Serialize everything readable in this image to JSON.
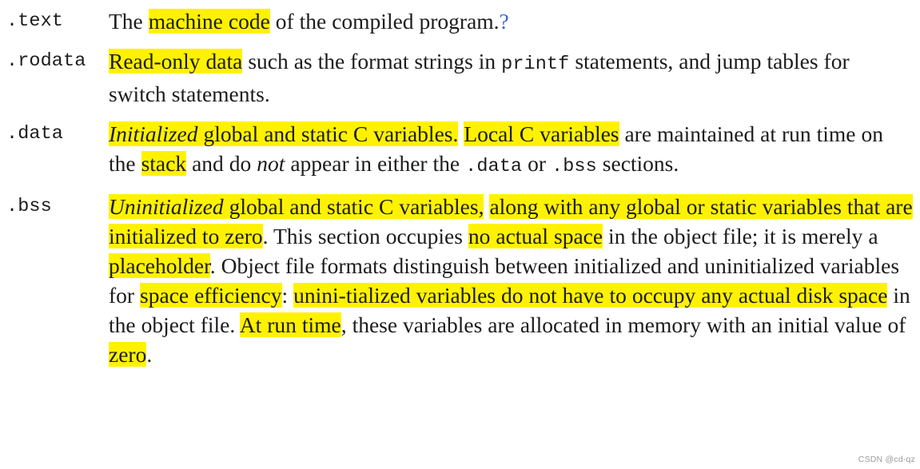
{
  "document": {
    "kind": "textbook-excerpt",
    "topic": "ELF object file sections",
    "highlight_color": "#fff200",
    "question_marker_color": "#3b5fd0",
    "text_color": "#1c1c1c"
  },
  "entries": [
    {
      "label": ".text",
      "id": "text",
      "segments": [
        {
          "text": "The ",
          "style": "plain"
        },
        {
          "text": "machine code",
          "style": "highlight"
        },
        {
          "text": " of the compiled program. ",
          "style": "plain"
        },
        {
          "text": "?",
          "style": "question-marker"
        }
      ],
      "plain": "The machine code of the compiled program. ?"
    },
    {
      "label": ".rodata",
      "id": "rodata",
      "segments": [
        {
          "text": "Read-only data",
          "style": "highlight"
        },
        {
          "text": " such as the format strings in ",
          "style": "plain"
        },
        {
          "text": "printf",
          "style": "mono"
        },
        {
          "text": " statements, and jump tables for switch statements.",
          "style": "plain"
        }
      ],
      "plain": "Read-only data such as the format strings in printf statements, and jump tables for switch statements."
    },
    {
      "label": ".data",
      "id": "data",
      "segments": [
        {
          "text": "Initialized",
          "style": "highlight-italic"
        },
        {
          "text": " global and static C variables.",
          "style": "highlight"
        },
        {
          "text": " ",
          "style": "plain"
        },
        {
          "text": "Local C variables",
          "style": "highlight"
        },
        {
          "text": " are maintained at run time on the ",
          "style": "plain"
        },
        {
          "text": "stack",
          "style": "highlight"
        },
        {
          "text": " and do ",
          "style": "plain"
        },
        {
          "text": "not",
          "style": "italic"
        },
        {
          "text": " appear in either the ",
          "style": "plain"
        },
        {
          "text": ".data",
          "style": "mono"
        },
        {
          "text": " or ",
          "style": "plain"
        },
        {
          "text": ".bss",
          "style": "mono"
        },
        {
          "text": " sections.",
          "style": "plain"
        }
      ],
      "plain": "Initialized global and static C variables. Local C variables are maintained at run time on the stack and do not appear in either the .data or .bss sections."
    },
    {
      "label": ".bss",
      "id": "bss",
      "segments": [
        {
          "text": "Uninitialized",
          "style": "highlight-italic"
        },
        {
          "text": " global and static C variables,",
          "style": "highlight"
        },
        {
          "text": " ",
          "style": "plain"
        },
        {
          "text": "along with any global or static variables that are initialized to zero",
          "style": "highlight"
        },
        {
          "text": ". This section occupies ",
          "style": "plain"
        },
        {
          "text": "no actual space",
          "style": "highlight"
        },
        {
          "text": " in the object file; it is merely a ",
          "style": "plain"
        },
        {
          "text": "placeholder",
          "style": "highlight"
        },
        {
          "text": ". Object file formats distinguish between initialized and uninitialized variables for ",
          "style": "plain"
        },
        {
          "text": "space efficiency",
          "style": "highlight"
        },
        {
          "text": ": ",
          "style": "plain"
        },
        {
          "text": "unini-tialized variables do not have to occupy any actual disk space",
          "style": "highlight"
        },
        {
          "text": " in the object file. ",
          "style": "plain"
        },
        {
          "text": "At run time",
          "style": "highlight"
        },
        {
          "text": ", these variables are allocated in memory with an initial value of ",
          "style": "plain"
        },
        {
          "text": "zero",
          "style": "highlight"
        },
        {
          "text": ".",
          "style": "plain"
        }
      ],
      "plain": "Uninitialized global and static C variables, along with any global or static variables that are initialized to zero. This section occupies no actual space in the object file; it is merely a placeholder. Object file formats distinguish between initialized and uninitialized variables for space efficiency: uninitialized variables do not have to occupy any actual disk space in the object file. At run time, these variables are allocated in memory with an initial value of zero."
    }
  ],
  "text_entry": {
    "label": ".text",
    "lead": "The ",
    "hl_machine_code": "machine code",
    "tail": " of the compiled program.",
    "question": "?"
  },
  "rodata_entry": {
    "label": ".rodata",
    "hl_readonly": "Read-only data",
    "mid": " such as the format strings in ",
    "mono_printf": "printf",
    "tail": " statements, and jump tables for switch statements."
  },
  "data_entry": {
    "label": ".data",
    "it_initialized": "Initialized",
    "hl_rest1": " global and static C variables.",
    "hl_local": "Local C variables",
    "mid1": " are maintained at run time on the ",
    "hl_stack": "stack",
    "mid2": " and do ",
    "it_not": "not",
    "mid3": " appear in either the ",
    "mono_data": ".data",
    "mid4": " or ",
    "mono_bss": ".bss",
    "tail": " sections."
  },
  "bss_entry": {
    "label": ".bss",
    "it_uninitialized": "Uninitialized",
    "hl_rest1": " global and static C variables,",
    "hl_along": "along with any global or static variables that are initialized to zero",
    "mid1": ". This section occupies ",
    "hl_nospace": "no actual space",
    "mid2": " in the object file; it is merely a ",
    "hl_placeholder": "placeholder",
    "mid3": ". Object file formats distinguish between initialized and uninitialized variables for ",
    "hl_efficiency": "space efficiency",
    "colon": ": ",
    "hl_unini": "unini-",
    "hl_tialized": "tialized variables do not have to occupy any actual disk space",
    "mid4": " in the object file. ",
    "hl_atruntime": "At run time",
    "mid5": ", these variables are allocated in memory with an initial value of ",
    "hl_zero": "zero",
    "period": "."
  },
  "watermark": {
    "text": "CSDN @cd-qz"
  }
}
